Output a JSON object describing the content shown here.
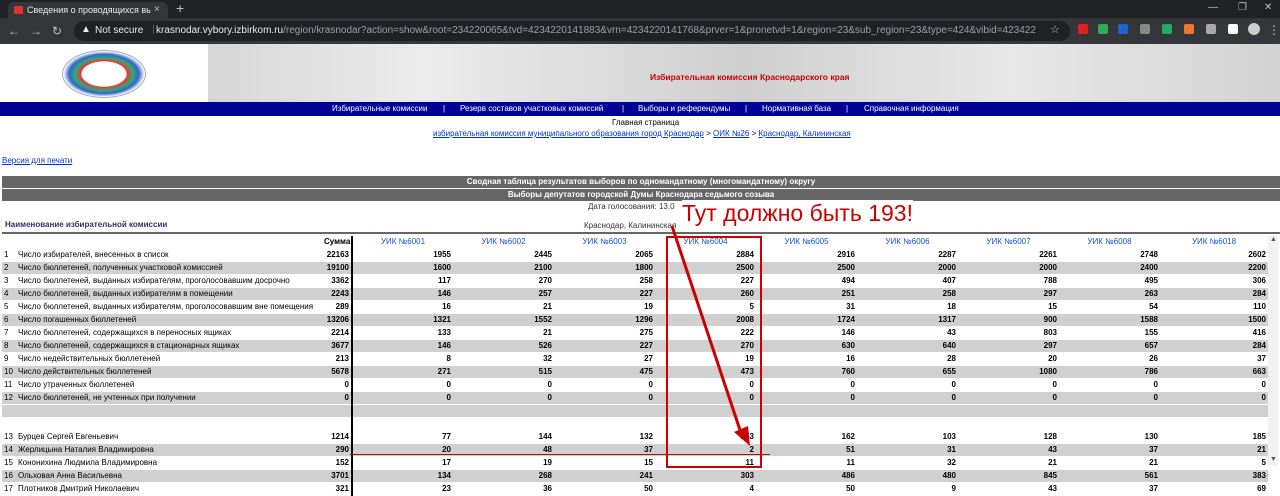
{
  "browser": {
    "tab_title": "Сведения о проводящихся выб",
    "new_tab": "+",
    "tab_close": "×",
    "security": "Not secure",
    "url_host": "krasnodar.vybory.izbirkom.ru",
    "url_path": "/region/krasnodar?action=show&root=234220065&tvd=4234220141883&vrn=4234220141768&prver=1&pronetvd=1&region=23&sub_region=23&type=424&vibid=4234220141883"
  },
  "header": {
    "title": "Избирательная комиссия Краснодарского края"
  },
  "nav": {
    "items": [
      "Избирательные комиссии",
      "Резерв составов участковых комиссий",
      "Выборы и референдумы",
      "Нормативная база",
      "Справочная информация"
    ],
    "sep": "|"
  },
  "breadcrumb": {
    "home": "Главная страница",
    "level1": "избирательная комиссия муниципального образования город Краснодар",
    "level2": "ОИК №26",
    "level3": "Краснодар, Калининская",
    "sep": ">"
  },
  "print_link": "Версия для печати",
  "report": {
    "title": "Сводная таблица результатов выборов по одномандатному (многомандатному) округу",
    "subtitle": "Выборы депутатов городской Думы Краснодара седьмого созыва",
    "vote_date_label": "Дата голосования:",
    "vote_date_value": "13.0",
    "location": "Краснодар, Калининская",
    "commission_label": "Наименование избирательной комиссии"
  },
  "table": {
    "sum_header": "Сумма",
    "uik_headers": [
      "УИК №6001",
      "УИК №6002",
      "УИК №6003",
      "УИК №6004",
      "УИК №6005",
      "УИК №6006",
      "УИК №6007",
      "УИК №6008",
      "УИК №6018"
    ],
    "rows": [
      {
        "no": "1",
        "name": "Число избирателей, внесенных в список",
        "sum": "22163",
        "vals": [
          "1955",
          "2445",
          "2065",
          "2884",
          "2916",
          "2287",
          "2261",
          "2748",
          "2602"
        ]
      },
      {
        "no": "2",
        "name": "Число бюллетеней, полученных участковой комиссией",
        "sum": "19100",
        "vals": [
          "1600",
          "2100",
          "1800",
          "2500",
          "2500",
          "2000",
          "2000",
          "2400",
          "2200"
        ]
      },
      {
        "no": "3",
        "name": "Число бюллетеней, выданных избирателям, проголосовавшим досрочно",
        "sum": "3362",
        "vals": [
          "117",
          "270",
          "258",
          "227",
          "494",
          "407",
          "788",
          "495",
          "306"
        ]
      },
      {
        "no": "4",
        "name": "Число бюллетеней, выданных избирателям в помещении",
        "sum": "2243",
        "vals": [
          "146",
          "257",
          "227",
          "260",
          "251",
          "258",
          "297",
          "263",
          "284"
        ]
      },
      {
        "no": "5",
        "name": "Число бюллетеней, выданных избирателям, проголосовавшим вне помещения",
        "sum": "289",
        "vals": [
          "16",
          "21",
          "19",
          "5",
          "31",
          "18",
          "15",
          "54",
          "110"
        ]
      },
      {
        "no": "6",
        "name": "Число погашенных бюллетеней",
        "sum": "13206",
        "vals": [
          "1321",
          "1552",
          "1296",
          "2008",
          "1724",
          "1317",
          "900",
          "1588",
          "1500"
        ]
      },
      {
        "no": "7",
        "name": "Число бюллетеней, содержащихся в переносных ящиках",
        "sum": "2214",
        "vals": [
          "133",
          "21",
          "275",
          "222",
          "146",
          "43",
          "803",
          "155",
          "416"
        ]
      },
      {
        "no": "8",
        "name": "Число бюллетеней, содержащихся в стационарных ящиках",
        "sum": "3677",
        "vals": [
          "146",
          "526",
          "227",
          "270",
          "630",
          "640",
          "297",
          "657",
          "284"
        ]
      },
      {
        "no": "9",
        "name": "Число недействительных бюллетеней",
        "sum": "213",
        "vals": [
          "8",
          "32",
          "27",
          "19",
          "16",
          "28",
          "20",
          "26",
          "37"
        ]
      },
      {
        "no": "10",
        "name": "Число действительных бюллетеней",
        "sum": "5678",
        "vals": [
          "271",
          "515",
          "475",
          "473",
          "760",
          "655",
          "1080",
          "786",
          "663"
        ]
      },
      {
        "no": "11",
        "name": "Число утраченных бюллетеней",
        "sum": "0",
        "vals": [
          "0",
          "0",
          "0",
          "0",
          "0",
          "0",
          "0",
          "0",
          "0"
        ]
      },
      {
        "no": "12",
        "name": "Число бюллетеней, не учтенных при получении",
        "sum": "0",
        "vals": [
          "0",
          "0",
          "0",
          "0",
          "0",
          "0",
          "0",
          "0",
          "0"
        ]
      }
    ],
    "candidates": [
      {
        "no": "13",
        "name": "Бурцев Сергей Евгеньевич",
        "sum": "1214",
        "vals": [
          "77",
          "144",
          "132",
          "153",
          "162",
          "103",
          "128",
          "130",
          "185"
        ]
      },
      {
        "no": "14",
        "name": "Жерлицына Наталия Владимировна",
        "sum": "290",
        "vals": [
          "20",
          "48",
          "37",
          "2",
          "51",
          "31",
          "43",
          "37",
          "21"
        ]
      },
      {
        "no": "15",
        "name": "Кононихина Людмила Владимировна",
        "sum": "152",
        "vals": [
          "17",
          "19",
          "15",
          "11",
          "11",
          "32",
          "21",
          "21",
          "5"
        ]
      },
      {
        "no": "16",
        "name": "Ольховая Анна Васильевна",
        "sum": "3701",
        "vals": [
          "134",
          "268",
          "241",
          "303",
          "486",
          "480",
          "845",
          "561",
          "383"
        ]
      },
      {
        "no": "17",
        "name": "Плотников Дмитрий Николаевич",
        "sum": "321",
        "vals": [
          "23",
          "36",
          "50",
          "4",
          "50",
          "9",
          "43",
          "37",
          "69"
        ]
      }
    ]
  },
  "annotation": {
    "text": "Тут должно быть 193!",
    "color": "#cc0000"
  },
  "colors": {
    "nav_bg": "#000099",
    "row_grey": "#d0d0d0",
    "link": "#0033cc",
    "header_red": "#cc0000"
  }
}
